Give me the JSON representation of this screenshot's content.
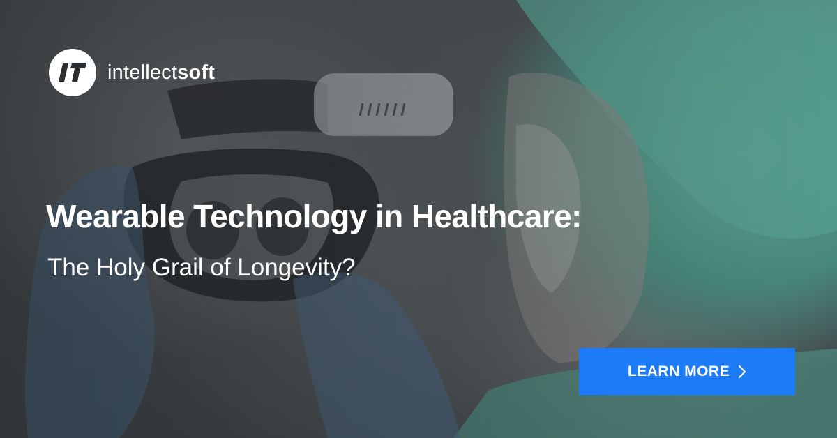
{
  "brand": {
    "name_light": "intellect",
    "name_bold": "soft",
    "logo_icon": "intellectsoft-logo-icon"
  },
  "headline": "Wearable Technology in Healthcare:",
  "subheadline": "The Holy Grail of Longevity?",
  "cta": {
    "label": "LEARN MORE",
    "icon": "chevron-right-icon"
  },
  "colors": {
    "accent": "#1c7bf5",
    "text": "#ffffff",
    "scrubs": "#4b8d80"
  }
}
